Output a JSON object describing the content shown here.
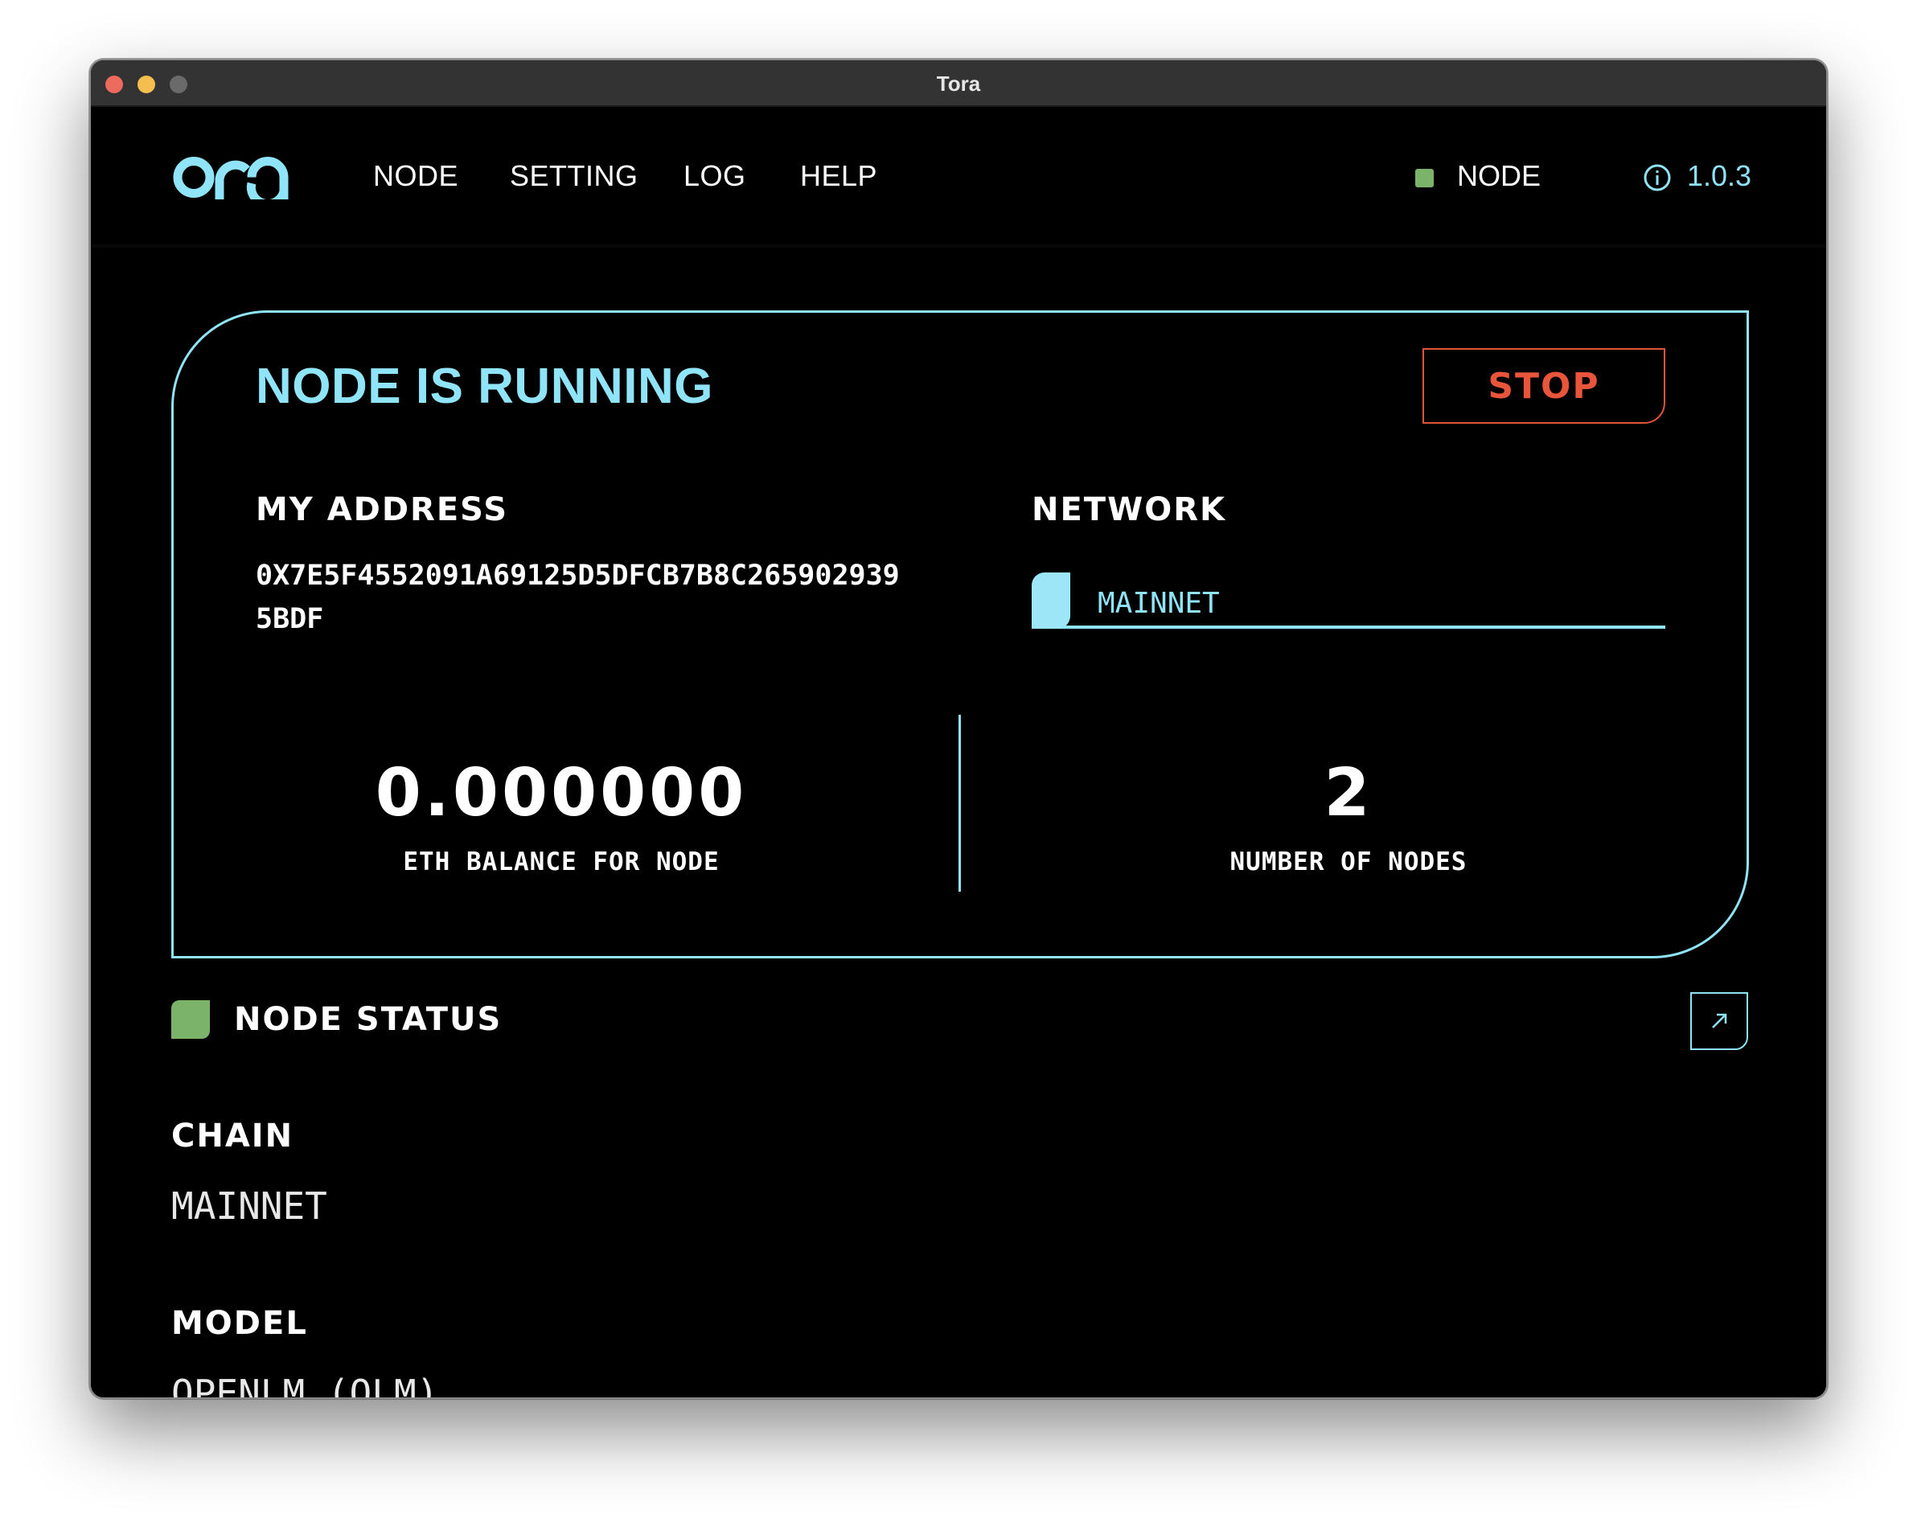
{
  "window": {
    "title": "Tora"
  },
  "nav": {
    "items": [
      {
        "label": "NODE"
      },
      {
        "label": "SETTING"
      },
      {
        "label": "LOG"
      },
      {
        "label": "HELP"
      }
    ],
    "node_status_label": "NODE",
    "version": "1.0.3"
  },
  "card": {
    "title": "NODE IS RUNNING",
    "stop_label": "STOP",
    "address_heading": "MY ADDRESS",
    "address": "0X7E5F4552091A69125D5DFCB7B8C2659029395BDF",
    "network_heading": "NETWORK",
    "network_value": "MAINNET",
    "balance_value": "0.000000",
    "balance_label": "ETH BALANCE FOR NODE",
    "nodes_value": "2",
    "nodes_label": "NUMBER OF NODES"
  },
  "status": {
    "heading": "NODE STATUS",
    "chain_heading": "CHAIN",
    "chain_value": "MAINNET",
    "model_heading": "MODEL",
    "model_value": "OPENLM (OLM)"
  },
  "colors": {
    "accent": "#8fe4f7",
    "stop": "#e8553a",
    "status_green": "#7cb36a",
    "background": "#000000"
  },
  "icons": [
    "ora-logo",
    "info-icon",
    "expand-icon"
  ]
}
